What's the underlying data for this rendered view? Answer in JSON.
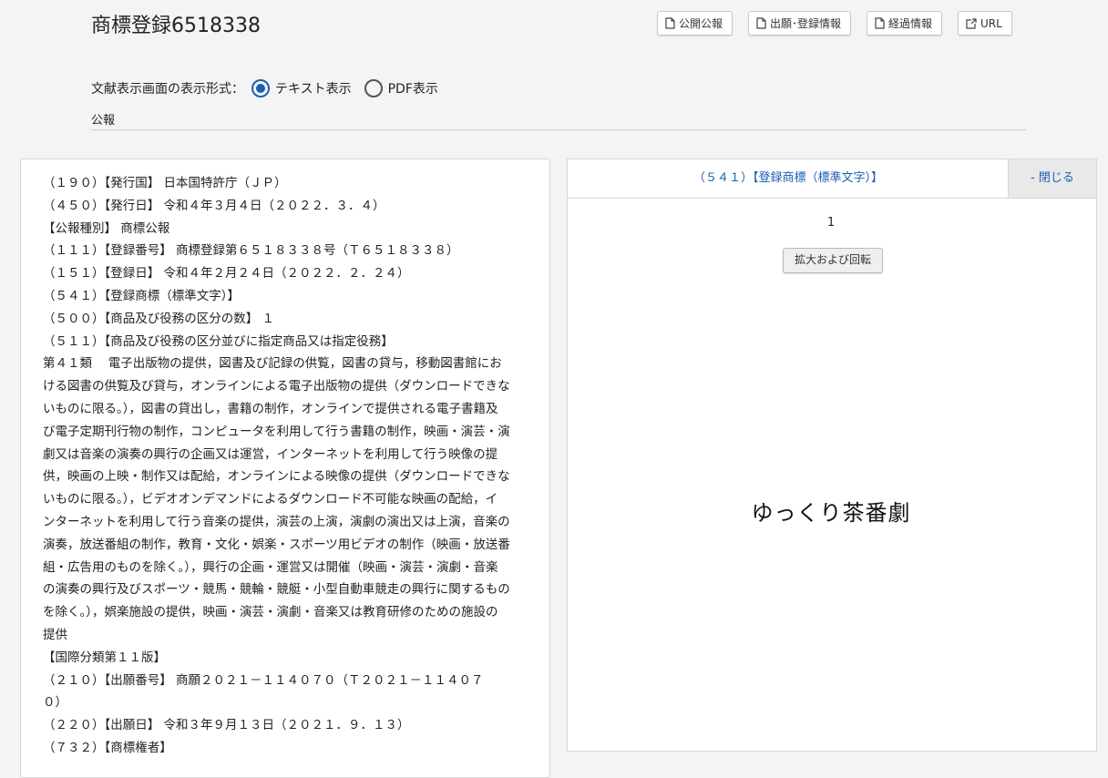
{
  "header": {
    "title": "商標登録6518338",
    "buttons": [
      {
        "label": "公開公報",
        "icon": "document-icon"
      },
      {
        "label": "出願･登録情報",
        "icon": "document-icon"
      },
      {
        "label": "経過情報",
        "icon": "document-icon"
      },
      {
        "label": "URL",
        "icon": "external-link-icon"
      }
    ]
  },
  "format": {
    "label": "文献表示画面の表示形式：",
    "options": [
      {
        "label": "テキスト表示",
        "selected": true
      },
      {
        "label": "PDF表示",
        "selected": false
      }
    ]
  },
  "section_label": "公報",
  "document": {
    "lines": [
      "（１９０）【発行国】 日本国特許庁（ＪＰ）",
      "（４５０）【発行日】 令和４年３月４日（２０２２．３．４）",
      "【公報種別】 商標公報",
      "（１１１）【登録番号】 商標登録第６５１８３３８号（Ｔ６５１８３３８）",
      "（１５１）【登録日】 令和４年２月２４日（２０２２．２．２４）",
      "（５４１）【登録商標（標準文字）】",
      "（５００）【商品及び役務の区分の数】 １",
      "（５１１）【商品及び役務の区分並びに指定商品又は指定役務】",
      "第４１類　 電子出版物の提供，図書及び記録の供覧，図書の貸与，移動図書館にお",
      "ける図書の供覧及び貸与，オンラインによる電子出版物の提供（ダウンロードできな",
      "いものに限る。），図書の貸出し，書籍の制作，オンラインで提供される電子書籍及",
      "び電子定期刊行物の制作，コンピュータを利用して行う書籍の制作，映画・演芸・演",
      "劇又は音楽の演奏の興行の企画又は運営，インターネットを利用して行う映像の提",
      "供，映画の上映・制作又は配給，オンラインによる映像の提供（ダウンロードできな",
      "いものに限る。），ビデオオンデマンドによるダウンロード不可能な映画の配給，イ",
      "ンターネットを利用して行う音楽の提供，演芸の上演，演劇の演出又は上演，音楽の",
      "演奏，放送番組の制作，教育・文化・娯楽・スポーツ用ビデオの制作（映画・放送番",
      "組・広告用のものを除く。），興行の企画・運営又は開催（映画・演芸・演劇・音楽",
      "の演奏の興行及びスポーツ・競馬・競輪・競艇・小型自動車競走の興行に関するもの",
      "を除く。），娯楽施設の提供，映画・演芸・演劇・音楽又は教育研修のための施設の",
      "提供",
      "【国際分類第１１版】",
      "（２１０）【出願番号】 商願２０２１－１１４０７０（Ｔ２０２１－１１４０７",
      "０）",
      "（２２０）【出願日】 令和３年９月１３日（２０２１．９．１３）",
      "（７３２）【商標権者】"
    ]
  },
  "viewer": {
    "title": "（５４１）【登録商標（標準文字）】",
    "close_label": "- 閉じる",
    "page_number": "1",
    "zoom_label": "拡大および回転",
    "trademark_text": "ゆっくり茶番劇"
  },
  "colors": {
    "accent": "#1a5fb4",
    "background": "#f4f4f4"
  }
}
